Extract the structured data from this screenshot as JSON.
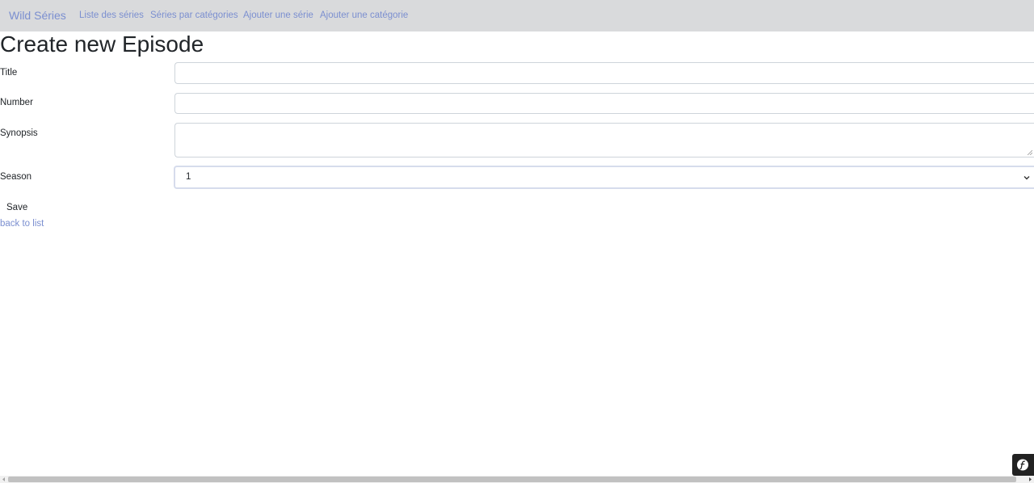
{
  "navbar": {
    "brand": "Wild Séries",
    "links": [
      "Liste des séries",
      "Séries par catégories",
      "Ajouter une série",
      "Ajouter une catégorie"
    ]
  },
  "page": {
    "title": "Create new Episode"
  },
  "form": {
    "title_label": "Title",
    "title_value": "",
    "number_label": "Number",
    "number_value": "",
    "synopsis_label": "Synopsis",
    "synopsis_value": "",
    "season_label": "Season",
    "season_value": "1",
    "save_label": "Save"
  },
  "back_link": "back to list",
  "icons": {
    "season_dropdown": "chevron-down-icon",
    "debug_toolbar": "symfony-logo-icon",
    "scroll_left": "arrow-left-icon",
    "scroll_right": "arrow-right-icon"
  },
  "colors": {
    "navbar_bg": "#d9dadc",
    "link": "#7b8fd0",
    "text": "#212529"
  }
}
